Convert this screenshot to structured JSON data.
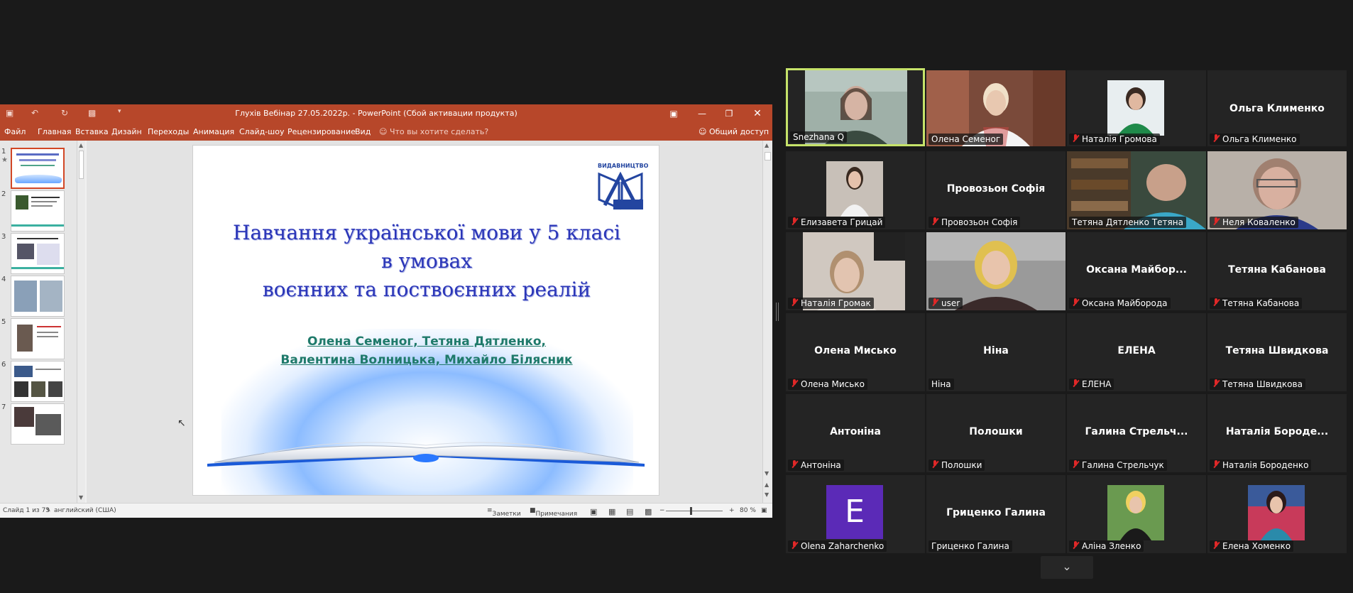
{
  "ppt": {
    "window_title": "Глухів Вебінар 27.05.2022р. - PowerPoint (Сбой активации продукта)",
    "ribbon_tabs": [
      "Файл",
      "Главная",
      "Вставка",
      "Дизайн",
      "Переходы",
      "Анимация",
      "Слайд-шоу",
      "Рецензирование",
      "Вид"
    ],
    "tell_me": "Что вы хотите сделать?",
    "share": "Общий доступ",
    "thumb_numbers": [
      "1",
      "2",
      "3",
      "4",
      "5",
      "6",
      "7"
    ],
    "slide": {
      "publisher": "ВИДАВНИЦТВО",
      "title_lines": [
        "Навчання української мови у 5 класі",
        "в умовах",
        "воєнних та поствоєнних реалій"
      ],
      "author_lines": [
        "Олена Семеног, Тетяна Дятленко,",
        "Валентина Волницька, Михайло Білясник"
      ]
    },
    "status": {
      "slide_count": "Слайд 1 из 73",
      "language": "английский (США)",
      "notes": "Заметки",
      "comments": "Примечания",
      "zoom": "80 %"
    },
    "colors": {
      "accent": "#b7472a",
      "title": "#2b36b8",
      "authors": "#1f7a6a"
    }
  },
  "participants": [
    {
      "name": "Snezhana Q",
      "video": true,
      "muted": false
    },
    {
      "name": "Олена Семеног",
      "video": true,
      "muted": false
    },
    {
      "name": "Наталія Громова",
      "video": true,
      "muted": true
    },
    {
      "name": "Ольга Клименко",
      "video": false,
      "muted": true
    },
    {
      "name": "Елизавета Грицай",
      "video": true,
      "muted": true
    },
    {
      "name": "Провозьон Софія",
      "video": false,
      "muted": true
    },
    {
      "name": "Тетяна Дятленко Тетяна",
      "video": true,
      "muted": false
    },
    {
      "name": "Неля Коваленко",
      "video": true,
      "muted": true
    },
    {
      "name": "Наталія Громак",
      "video": true,
      "muted": true
    },
    {
      "name": "user",
      "video": true,
      "muted": true
    },
    {
      "name": "Оксана Майборода",
      "video": false,
      "muted": true,
      "display": "Оксана  Майбор..."
    },
    {
      "name": "Тетяна Кабанова",
      "video": false,
      "muted": true
    },
    {
      "name": "Олена Мисько",
      "video": false,
      "muted": true
    },
    {
      "name": "Ніна",
      "video": false,
      "muted": false
    },
    {
      "name": "ЕЛЕНА",
      "video": false,
      "muted": true
    },
    {
      "name": "Тетяна Швидкова",
      "video": false,
      "muted": true
    },
    {
      "name": "Антоніна",
      "video": false,
      "muted": true
    },
    {
      "name": "Полошки",
      "video": false,
      "muted": true
    },
    {
      "name": "Галина Стрельчук",
      "video": false,
      "muted": true,
      "display": "Галина  Стрельч..."
    },
    {
      "name": "Наталія Бороденко",
      "video": false,
      "muted": true,
      "display": "Наталія  Бороде..."
    },
    {
      "name": "Olena Zaharchenko",
      "video": false,
      "muted": true,
      "avatar": "E"
    },
    {
      "name": "Гриценко Галина",
      "video": false,
      "muted": false
    },
    {
      "name": "Аліна Зленко",
      "video": true,
      "muted": true
    },
    {
      "name": "Елена Хоменко",
      "video": true,
      "muted": true
    }
  ],
  "gallery_nav": {
    "icon": "chevron-down-icon"
  }
}
